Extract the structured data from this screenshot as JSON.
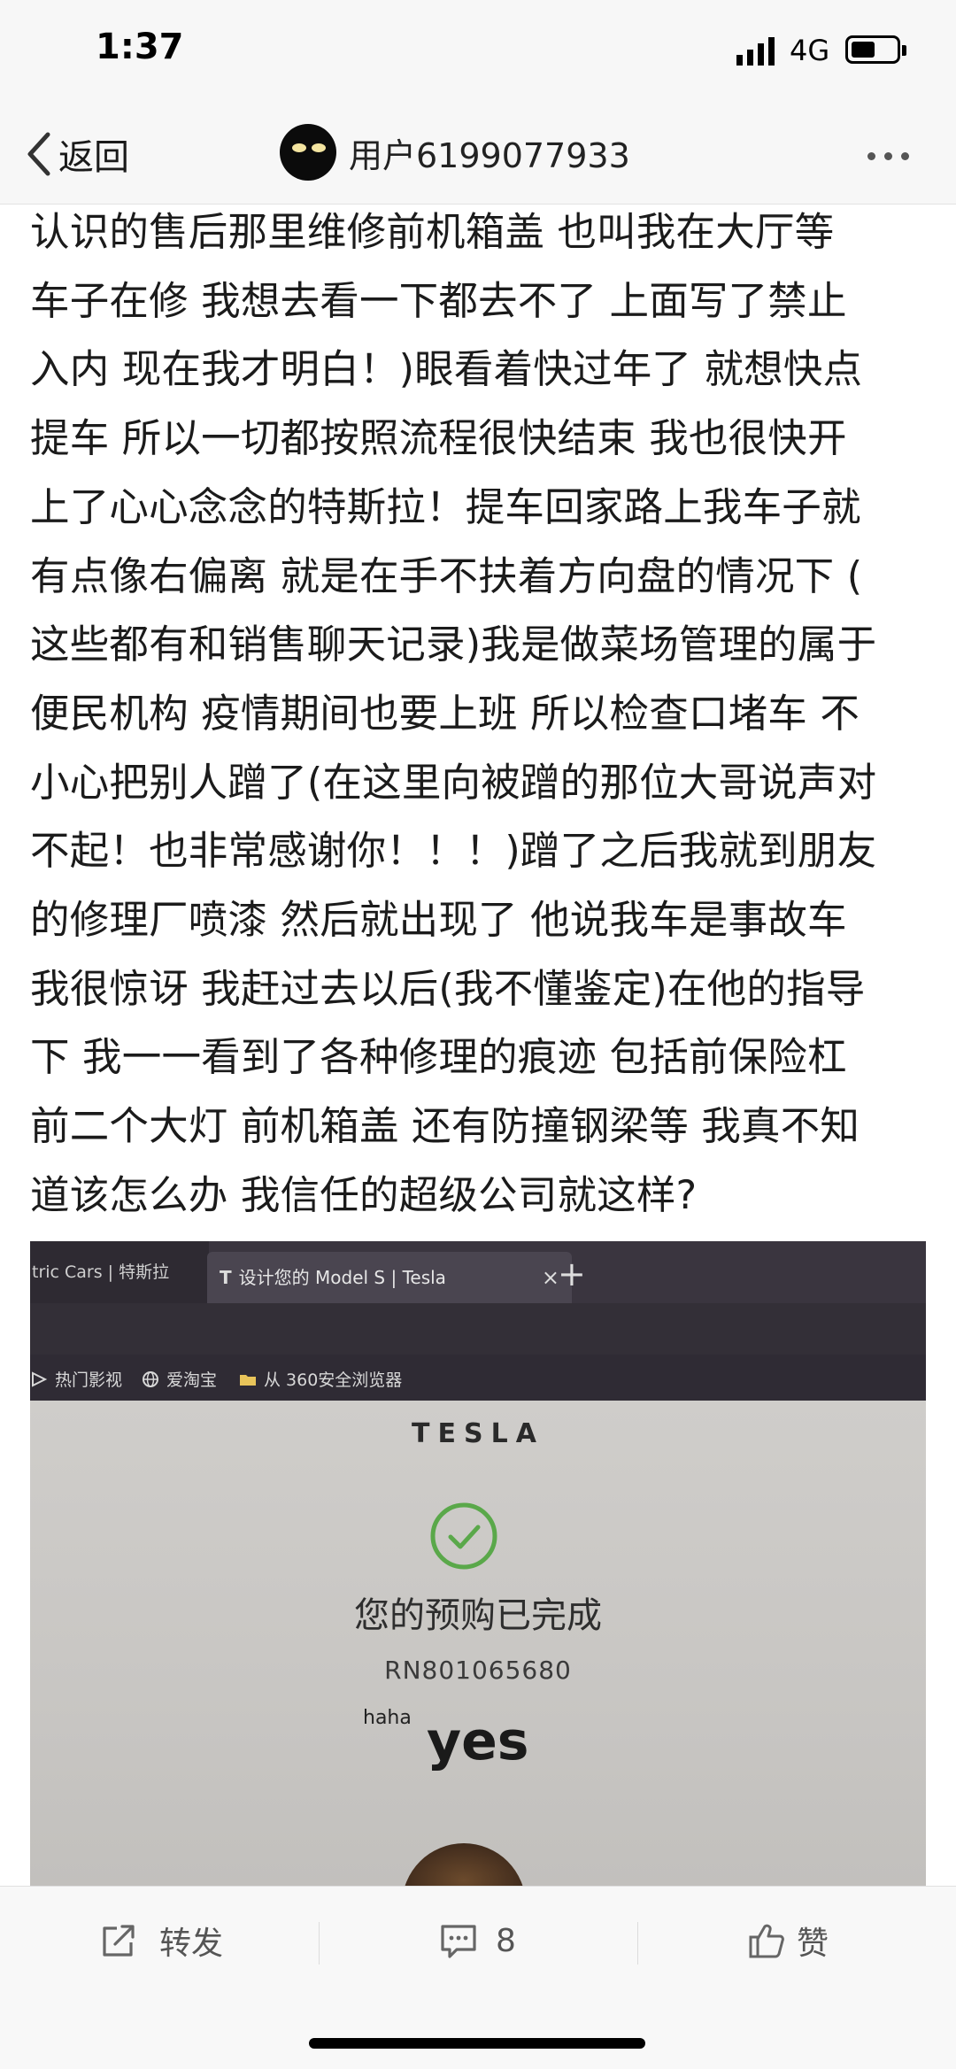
{
  "status_bar": {
    "time": "1:37",
    "network": "4G"
  },
  "nav": {
    "back_label": "返回",
    "username": "用户6199077933"
  },
  "article": {
    "lines": [
      "认识的售后那里维修前机箱盖 也叫我在大厅等",
      "车子在修 我想去看一下都去不了 上面写了禁止",
      "入内 现在我才明白！)眼看着快过年了 就想快点",
      "提车 所以一切都按照流程很快结束 我也很快开",
      "上了心心念念的特斯拉！提车回家路上我车子就",
      "有点像右偏离 就是在手不扶着方向盘的情况下 (",
      "这些都有和销售聊天记录)我是做菜场管理的属于",
      "便民机构 疫情期间也要上班 所以检查口堵车 不",
      "小心把别人蹭了(在这里向被蹭的那位大哥说声对",
      "不起！也非常感谢你！！！)蹭了之后我就到朋友",
      "的修理厂喷漆 然后就出现了 他说我车是事故车",
      "我很惊讶 我赶过去以后(我不懂鉴定)在他的指导",
      "下 我一一看到了各种修理的痕迹 包括前保险杠",
      "前二个大灯 前机箱盖 还有防撞钢梁等 我真不知",
      "道该怎么办 我信任的超级公司就这样?"
    ]
  },
  "photo": {
    "tab_prev": "tric Cars | 特斯拉",
    "tab_active": "设计您的 Model S | Tesla",
    "bookmarks": [
      "热门影视",
      "爱淘宝",
      "从 360安全浏览器"
    ],
    "brand": "TESLA",
    "order_done": "您的预购已完成",
    "order_number": "RN801065680",
    "caption_small": "haha",
    "caption_big": "yes"
  },
  "actions": {
    "repost_label": "转发",
    "comment_count": "8",
    "like_label": "赞"
  },
  "colors": {
    "check_green": "#5aa84a",
    "action_icon": "#666666"
  }
}
